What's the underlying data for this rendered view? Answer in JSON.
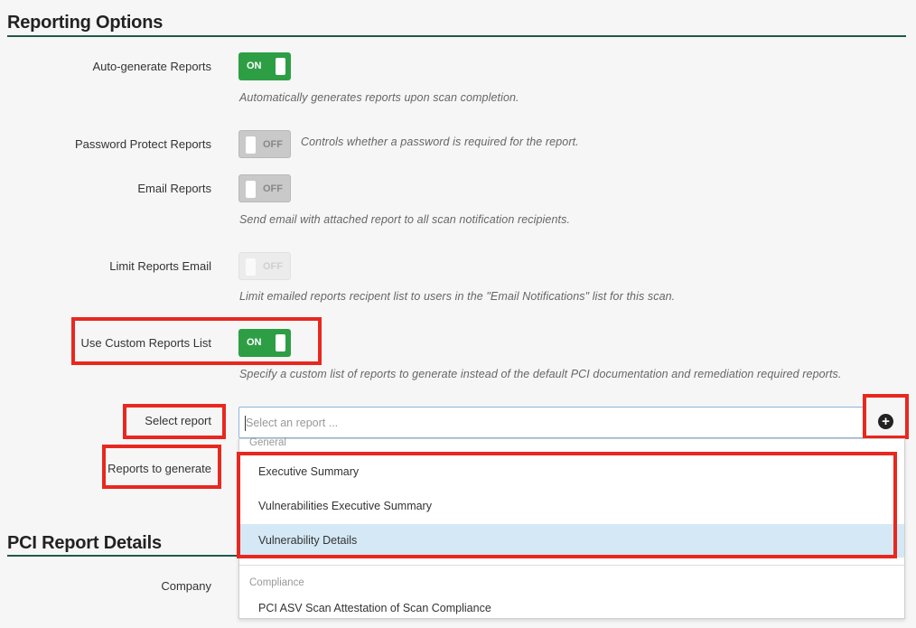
{
  "reporting": {
    "title": "Reporting Options",
    "auto_generate": {
      "label": "Auto-generate Reports",
      "state": "ON",
      "help": "Automatically generates reports upon scan completion."
    },
    "password_protect": {
      "label": "Password Protect Reports",
      "state": "OFF",
      "help": "Controls whether a password is required for the report."
    },
    "email_reports": {
      "label": "Email Reports",
      "state": "OFF",
      "help": "Send email with attached report to all scan notification recipients."
    },
    "limit_email": {
      "label": "Limit Reports Email",
      "state": "OFF",
      "help": "Limit emailed reports recipent list to users in the \"Email Notifications\" list for this scan."
    },
    "custom_list": {
      "label": "Use Custom Reports List",
      "state": "ON",
      "help": "Specify a custom list of reports to generate instead of the default PCI documentation and remediation required reports."
    },
    "select_report": {
      "label": "Select report",
      "placeholder": "Select an report ..."
    },
    "reports_to_generate": {
      "label": "Reports to generate"
    }
  },
  "dropdown": {
    "groups": [
      {
        "label": "General",
        "options": [
          "Executive Summary",
          "Vulnerabilities Executive Summary",
          "Vulnerability Details"
        ]
      },
      {
        "label": "Compliance",
        "options": [
          "PCI ASV Scan Attestation of Scan Compliance"
        ]
      }
    ],
    "selected": "Vulnerability Details"
  },
  "pci": {
    "title": "PCI Report Details",
    "company_label": "Company"
  },
  "icons": {
    "add": "plus-circle-icon"
  },
  "colors": {
    "toggle_on": "#2e9e45",
    "highlight": "#e8281f",
    "rule": "#1e5b4a",
    "selected_option": "#d4e8f5"
  }
}
